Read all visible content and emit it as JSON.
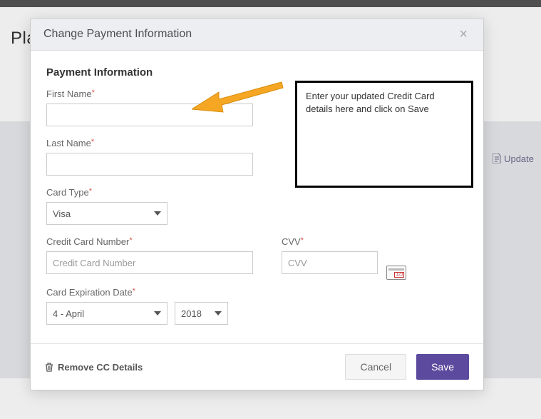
{
  "background": {
    "page_title": "Plan",
    "update_link_text": "Update"
  },
  "modal": {
    "title": "Change Payment Information",
    "section_heading": "Payment Information",
    "hint_text": "Enter your updated Credit Card details here and click on Save",
    "labels": {
      "first_name": "First Name",
      "last_name": "Last Name",
      "card_type": "Card Type",
      "cc_number": "Credit Card Number",
      "cvv": "CVV",
      "expiration": "Card Expiration Date"
    },
    "placeholders": {
      "cc_number": "Credit Card Number",
      "cvv": "CVV"
    },
    "values": {
      "first_name": "",
      "last_name": "",
      "card_type": "Visa",
      "cc_number": "",
      "cvv": "",
      "exp_month": "4 - April",
      "exp_year": "2018"
    },
    "footer": {
      "remove_label": "Remove CC Details",
      "cancel_label": "Cancel",
      "save_label": "Save"
    }
  }
}
